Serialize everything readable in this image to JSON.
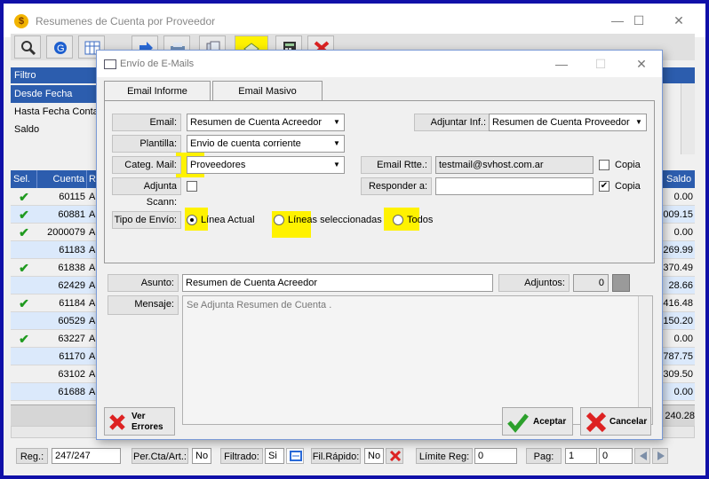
{
  "window": {
    "title": "Resumenes de Cuenta por Proveedor",
    "app_icon": "logo-icon",
    "controls": {
      "minimize": "—",
      "maximize": "☐",
      "close": "✕"
    }
  },
  "filter": {
    "header": "Filtro",
    "rows": [
      "Desde Fecha Conta",
      "Hasta Fecha Conta",
      "Saldo"
    ]
  },
  "grid": {
    "headers": {
      "sel": "Sel.",
      "cuenta": "Cuenta",
      "r": "R",
      "saldo": "Saldo"
    },
    "rows": [
      {
        "checked": true,
        "cuenta": "60115",
        "r": "A",
        "saldo": "0.00"
      },
      {
        "checked": true,
        "cuenta": "60881",
        "r": "A",
        "saldo": "009.15"
      },
      {
        "checked": true,
        "cuenta": "2000079",
        "r": "A",
        "saldo": "0.00"
      },
      {
        "checked": false,
        "cuenta": "61183",
        "r": "A",
        "saldo": "269.99"
      },
      {
        "checked": true,
        "cuenta": "61838",
        "r": "A",
        "saldo": "370.49"
      },
      {
        "checked": false,
        "cuenta": "62429",
        "r": "A",
        "saldo": "28.66"
      },
      {
        "checked": true,
        "cuenta": "61184",
        "r": "A",
        "saldo": "416.48"
      },
      {
        "checked": false,
        "cuenta": "60529",
        "r": "A",
        "saldo": "150.20"
      },
      {
        "checked": true,
        "cuenta": "63227",
        "r": "A",
        "saldo": "0.00"
      },
      {
        "checked": false,
        "cuenta": "61170",
        "r": "A",
        "saldo": "787.75"
      },
      {
        "checked": false,
        "cuenta": "63102",
        "r": "A",
        "saldo": "309.50"
      },
      {
        "checked": false,
        "cuenta": "61688",
        "r": "A",
        "saldo": "0.00"
      }
    ],
    "check_glyph": "✔",
    "total_saldo": "240.28"
  },
  "statusbar": {
    "reg_label": "Reg.:",
    "reg_value": "247/247",
    "percta_label": "Per.Cta/Art.:",
    "percta_value": "No",
    "filtrado_label": "Filtrado:",
    "filtrado_value": "Si",
    "filrapido_label": "Fil.Rápido:",
    "filrapido_value": "No",
    "limite_label": "Límite Reg:",
    "limite_value": "0",
    "pag_label": "Pag:",
    "pag_value": "1",
    "pag_total": "0"
  },
  "dialog": {
    "title": "Envío de E-Mails",
    "tabs": [
      "Email Informe",
      "Email Masivo"
    ],
    "email_label": "Email:",
    "email_value": "Resumen de Cuenta Acreedor",
    "plantilla_label": "Plantilla:",
    "plantilla_value": "Envio de cuenta corriente",
    "categ_label": "Categ. Mail:",
    "categ_value": "Proveedores",
    "adjscann_label": "Adjunta Scann:",
    "adjuntar_label": "Adjuntar Inf.:",
    "adjuntar_value": "Resumen de Cuenta Proveedor",
    "rtte_label": "Email Rtte.:",
    "rtte_value": "testmail@svhost.com.ar",
    "copia1_label": "Copia",
    "responder_label": "Responder a:",
    "responder_value": "",
    "copia2_label": "Copia",
    "tipo_label": "Tipo de Envío:",
    "radio_actual": "Línea Actual",
    "radio_sel": "Líneas seleccionadas",
    "radio_todos": "Todos",
    "asunto_label": "Asunto:",
    "asunto_value": "Resumen de Cuenta Acreedor",
    "adjuntos_label": "Adjuntos:",
    "adjuntos_value": "0",
    "mensaje_label": "Mensaje:",
    "mensaje_value": "Se Adjunta Resumen de Cuenta .",
    "ver_errores": "Ver Errores",
    "aceptar": "Aceptar",
    "cancelar": "Cancelar"
  },
  "colors": {
    "accent": "#2c5dae",
    "highlight": "#fff200",
    "check": "#1f9a1f"
  }
}
